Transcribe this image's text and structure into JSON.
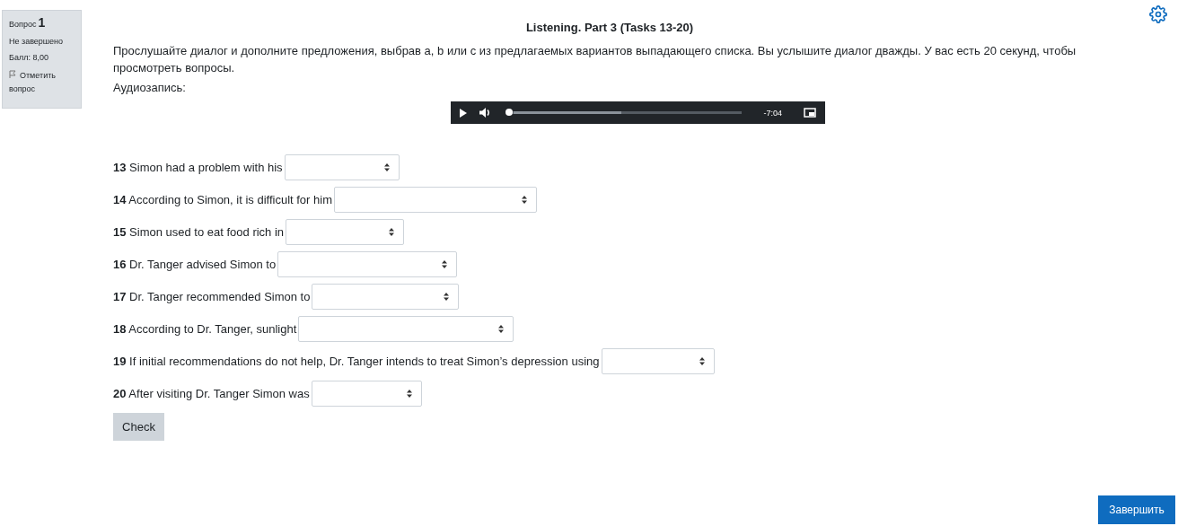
{
  "question_info": {
    "label": "Вопрос",
    "number": "1",
    "status": "Не завершено",
    "score": "Балл: 8,00",
    "flag": "Отметить вопрос"
  },
  "title": "Listening. Part 3 (Tasks 13-20)",
  "instructions": "Прослушайте диалог и дополните предложения, выбрав a, b или c из предлагаемых вариантов выпадающего списка. Вы услышите диалог дважды. У вас есть 20 секунд, чтобы просмотреть вопросы.",
  "audio_label": "Аудиозапись:",
  "player": {
    "time": "-7:04",
    "level": 0
  },
  "questions": [
    {
      "text": "**13** Simon had a problem with his"
    },
    {
      "text": "**14** According to Simon, it is difficult for him"
    },
    {
      "text": "**15** Simon used to eat food rich in"
    },
    {
      "text": "**16** Dr. Tanger advised Simon to"
    },
    {
      "text": "**17** Dr. Tanger recommended Simon to"
    },
    {
      "text": "**18** According to Dr. Tanger, sunlight"
    },
    {
      "text": "**19** If initial recommendations do not help, Dr. Tanger intends to treat Simon’s depression using"
    },
    {
      "text": "**20** After visiting Dr. Tanger Simon was"
    }
  ],
  "check_button": "Check",
  "finish_button": "Завершить"
}
